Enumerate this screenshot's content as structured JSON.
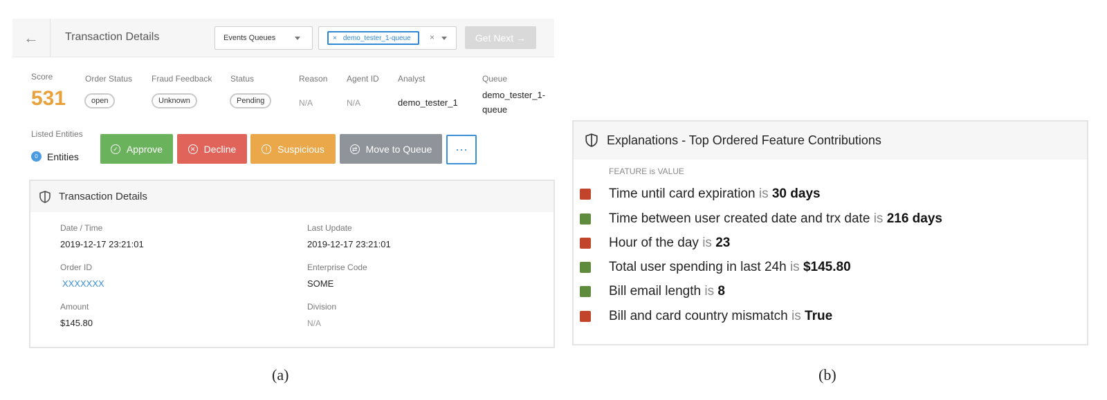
{
  "panel_a": {
    "header": {
      "title": "Transaction Details",
      "queue_select": {
        "label": "Events Queues"
      },
      "tag_select": {
        "chip": "demo_tester_1-queue",
        "chip_remove": "×",
        "clear": "×"
      },
      "get_next": "Get Next →"
    },
    "fields": {
      "score": {
        "label": "Score",
        "value": "531"
      },
      "order_status": {
        "label": "Order Status",
        "value": "open"
      },
      "fraud_feedback": {
        "label": "Fraud Feedback",
        "value": "Unknown"
      },
      "status": {
        "label": "Status",
        "value": "Pending"
      },
      "reason": {
        "label": "Reason",
        "value": "N/A"
      },
      "agent_id": {
        "label": "Agent ID",
        "value": "N/A"
      },
      "analyst": {
        "label": "Analyst",
        "value": "demo_tester_1"
      },
      "queue": {
        "label": "Queue",
        "value_line1": "demo_tester_1-",
        "value_line2": "queue"
      }
    },
    "entities": {
      "label": "Listed Entities",
      "count": "0",
      "text": "Entities"
    },
    "actions": {
      "approve": "Approve",
      "decline": "Decline",
      "suspicious": "Suspicious",
      "move": "Move to Queue",
      "more": "···"
    },
    "details_card": {
      "title": "Transaction Details",
      "date_time": {
        "label": "Date / Time",
        "value": "2019-12-17 23:21:01"
      },
      "last_update": {
        "label": "Last Update",
        "value": "2019-12-17 23:21:01"
      },
      "order_id": {
        "label": "Order ID",
        "value": "XXXXXXX"
      },
      "enterprise_code": {
        "label": "Enterprise Code",
        "value": "SOME"
      },
      "amount": {
        "label": "Amount",
        "value": "$145.80"
      },
      "division": {
        "label": "Division",
        "value": "N/A"
      }
    },
    "caption": "(a)"
  },
  "panel_b": {
    "title": "Explanations - Top Ordered Feature Contributions",
    "column_header": "FEATURE is VALUE",
    "is_word": "is",
    "colors": {
      "negative": "#c2452b",
      "positive": "#5f8b3c"
    },
    "features": [
      {
        "name": "Time until card expiration",
        "value": "30 days",
        "impact": "negative"
      },
      {
        "name": "Time between user created date and trx date",
        "value": "216 days",
        "impact": "positive"
      },
      {
        "name": "Hour of the day",
        "value": "23",
        "impact": "negative"
      },
      {
        "name": "Total user spending in last 24h",
        "value": "$145.80",
        "impact": "positive"
      },
      {
        "name": "Bill email length",
        "value": "8",
        "impact": "positive"
      },
      {
        "name": "Bill and card country mismatch",
        "value": "True",
        "impact": "negative"
      }
    ],
    "caption": "(b)"
  }
}
